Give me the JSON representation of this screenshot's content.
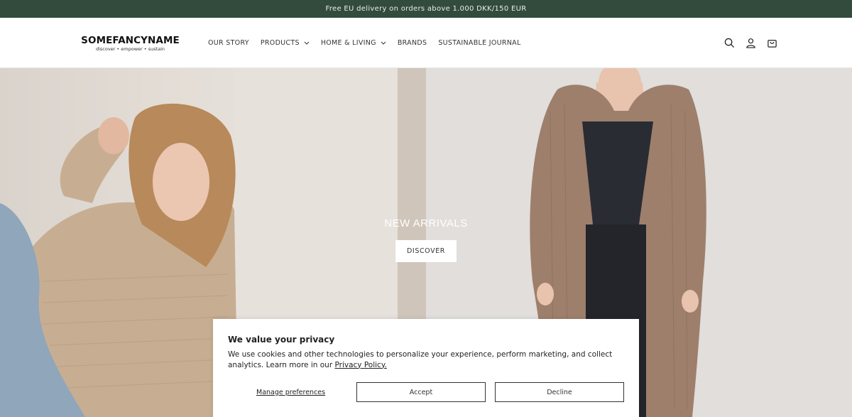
{
  "announcement": {
    "text": "Free EU delivery on orders above 1.000 DKK/150 EUR"
  },
  "logo": {
    "name": "SOMEFANCYNAME",
    "tagline": "discover • empower • sustain"
  },
  "nav": {
    "items": [
      {
        "label": "OUR STORY",
        "has_dropdown": false
      },
      {
        "label": "PRODUCTS",
        "has_dropdown": true
      },
      {
        "label": "HOME & LIVING",
        "has_dropdown": true
      },
      {
        "label": "BRANDS",
        "has_dropdown": false
      },
      {
        "label": "SUSTAINABLE JOURNAL",
        "has_dropdown": false
      }
    ]
  },
  "header_icons": [
    "search-icon",
    "account-icon",
    "cart-icon"
  ],
  "hero": {
    "title": "NEW ARRIVALS",
    "button_label": "DISCOVER"
  },
  "cookie": {
    "title": "We value your privacy",
    "text": "We use cookies and other technologies to personalize your experience, perform marketing, and collect analytics. Learn more in our",
    "link_label": "Privacy Policy.",
    "manage_label": "Manage preferences",
    "accept_label": "Accept",
    "decline_label": "Decline"
  },
  "colors": {
    "announcement_bg": "#334b3d",
    "announcement_text": "#e8efe9"
  }
}
